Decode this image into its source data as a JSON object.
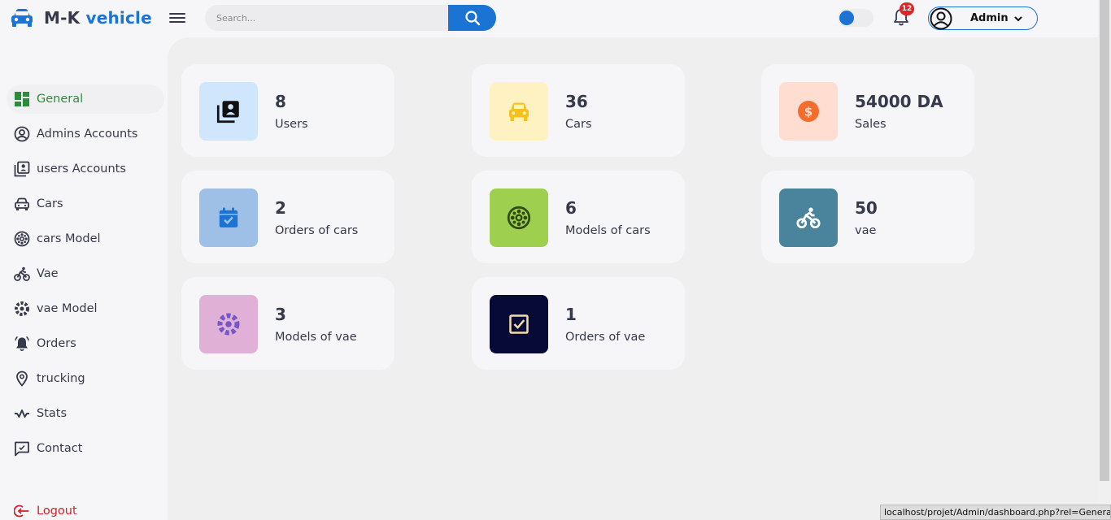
{
  "header": {
    "logo_prefix": "M-K",
    "logo_suffix": "vehicle",
    "search_placeholder": "Search...",
    "notification_count": "12",
    "profile_name": "Admin"
  },
  "sidebar": {
    "items": [
      {
        "label": "General",
        "icon": "grid-icon",
        "active": true
      },
      {
        "label": "Admins Accounts",
        "icon": "user-circle-icon"
      },
      {
        "label": "users Accounts",
        "icon": "contacts-icon"
      },
      {
        "label": "Cars",
        "icon": "car-icon"
      },
      {
        "label": "cars Model",
        "icon": "wheel-icon"
      },
      {
        "label": "Vae",
        "icon": "bike-icon"
      },
      {
        "label": "vae Model",
        "icon": "tire-icon"
      },
      {
        "label": "Orders",
        "icon": "bell-icon"
      },
      {
        "label": "trucking",
        "icon": "location-icon"
      },
      {
        "label": "Stats",
        "icon": "pulse-icon"
      },
      {
        "label": "Contact",
        "icon": "message-icon"
      }
    ],
    "logout_label": "Logout"
  },
  "cards": [
    {
      "value": "8",
      "caption": "Users",
      "color": "#cfe6fd",
      "icon": "contacts-icon"
    },
    {
      "value": "36",
      "caption": "Cars",
      "color": "#fff2c2",
      "icon": "car-icon"
    },
    {
      "value": "54000 DA",
      "caption": "Sales",
      "color": "#ffddd0",
      "icon": "dollar-icon"
    },
    {
      "value": "2",
      "caption": "Orders of cars",
      "color": "#9ec0e6",
      "icon": "calendar-check-icon"
    },
    {
      "value": "6",
      "caption": "Models of cars",
      "color": "#9ecf4e",
      "icon": "wheel-icon"
    },
    {
      "value": "50",
      "caption": "vae",
      "color": "#4a849c",
      "icon": "bike-icon"
    },
    {
      "value": "3",
      "caption": "Models of vae",
      "color": "#e0b0d6",
      "icon": "tire-icon"
    },
    {
      "value": "1",
      "caption": "Orders of vae",
      "color": "#070a36",
      "icon": "checkbox-icon"
    }
  ],
  "status_url": "localhost/projet/Admin/dashboard.php?rel=General"
}
